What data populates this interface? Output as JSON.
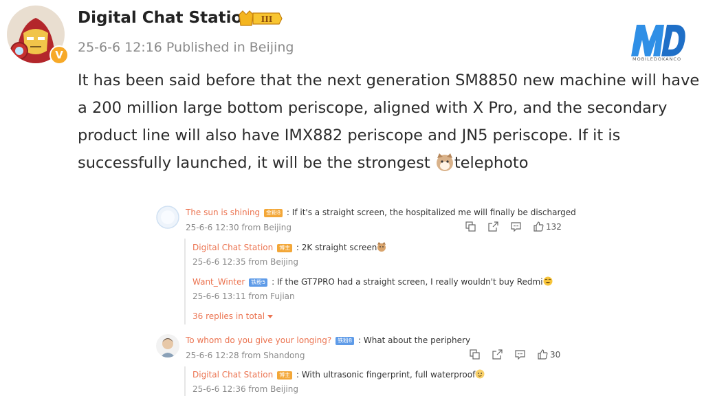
{
  "post": {
    "author": "Digital Chat Station",
    "level_badge": "III",
    "meta": "25-6-6 12:16 Published in Beijing",
    "text": "It has been said before that the next generation SM8850 new machine will have a 200 million large bottom periscope, aligned with X Pro, and the secondary product line will also have IMX882 periscope and JN5 periscope. If it is successfully launched, it will be the strongest ",
    "text_tail": "telephoto",
    "verified_mark": "V"
  },
  "logo": {
    "text": "MD",
    "subtitle": "MOBILEDOKANCO"
  },
  "comments": [
    {
      "user": "The sun is shining",
      "badge": "金粉8",
      "text": ": If it's a straight screen, the hospitalized me will finally be discharged",
      "meta": "25-6-6 12:30 from Beijing",
      "likes": "132",
      "replies": [
        {
          "user": "Digital Chat Station",
          "badge": "博主",
          "text": ": 2K straight screen",
          "meta": "25-6-6 12:35 from Beijing"
        },
        {
          "user": "Want_Winter",
          "badge": "铁粉5",
          "text": ": If the GT7PRO had a straight screen, I really wouldn't buy Redmi",
          "meta": "25-6-6 13:11 from Fujian"
        }
      ],
      "more": "36 replies in total"
    },
    {
      "user": "To whom do you give your longing?",
      "badge": "铁粉8",
      "text": ": What about the periphery",
      "meta": "25-6-6 12:28 from Shandong",
      "likes": "30",
      "replies": [
        {
          "user": "Digital Chat Station",
          "badge": "博主",
          "text": ": With ultrasonic fingerprint, full waterproof",
          "meta": "25-6-6 12:36 from Beijing"
        }
      ]
    }
  ],
  "colors": {
    "username": "#eb7350",
    "meta": "#8a8a8a",
    "badge_orange": "#f3a738",
    "badge_blue": "#5e9be8"
  }
}
